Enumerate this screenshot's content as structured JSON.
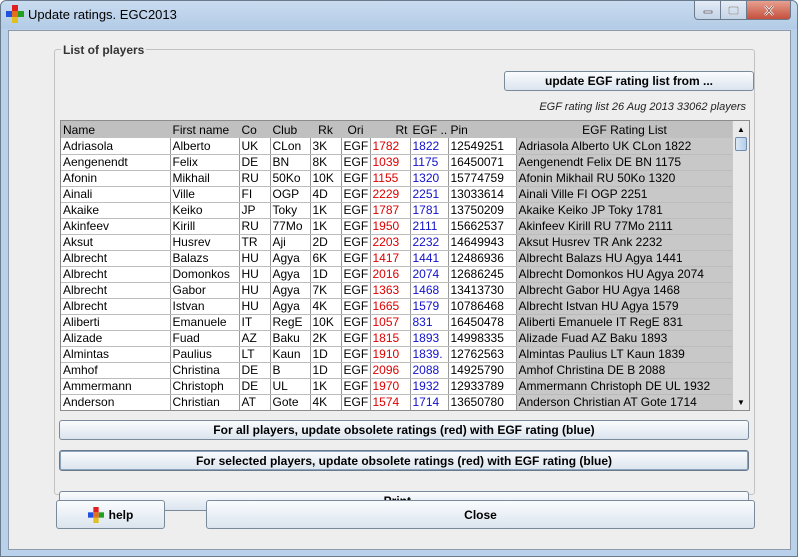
{
  "window": {
    "title": "Update ratings. EGC2013",
    "icons": [
      "app-logo-icon",
      "minimize-icon",
      "maximize-icon",
      "close-icon"
    ]
  },
  "group": {
    "title": "List of players",
    "update_list_label": "update EGF rating list from ...",
    "rating_info": "EGF rating list 26 Aug 2013 33062 players"
  },
  "table": {
    "columns": [
      "Name",
      "First name",
      "Co",
      "Club",
      "Rk",
      "Ori",
      "Rt",
      "EGF ...",
      "Pin",
      "EGF Rating List"
    ],
    "rows": [
      [
        "Adriasola",
        "Alberto",
        "UK",
        "CLon",
        "3K",
        "EGF",
        "1782",
        "1822",
        "12549251",
        "Adriasola Alberto UK CLon 1822"
      ],
      [
        "Aengenendt",
        "Felix",
        "DE",
        "BN",
        "8K",
        "EGF",
        "1039",
        "1175",
        "16450071",
        "Aengenendt Felix DE BN 1175"
      ],
      [
        "Afonin",
        "Mikhail",
        "RU",
        "50Ko",
        "10K",
        "EGF",
        "1155",
        "1320",
        "15774759",
        "Afonin Mikhail RU 50Ko 1320"
      ],
      [
        "Ainali",
        "Ville",
        "FI",
        "OGP",
        "4D",
        "EGF",
        "2229",
        "2251",
        "13033614",
        "Ainali Ville FI OGP 2251"
      ],
      [
        "Akaike",
        "Keiko",
        "JP",
        "Toky",
        "1K",
        "EGF",
        "1787",
        "1781",
        "13750209",
        "Akaike Keiko JP Toky 1781"
      ],
      [
        "Akinfeev",
        "Kirill",
        "RU",
        "77Mo",
        "1K",
        "EGF",
        "1950",
        "2111",
        "15662537",
        "Akinfeev Kirill RU 77Mo 2111"
      ],
      [
        "Aksut",
        "Husrev",
        "TR",
        "Aji",
        "2D",
        "EGF",
        "2203",
        "2232",
        "14649943",
        "Aksut Husrev TR Ank 2232"
      ],
      [
        "Albrecht",
        "Balazs",
        "HU",
        "Agya",
        "6K",
        "EGF",
        "1417",
        "1441",
        "12486936",
        "Albrecht Balazs HU Agya 1441"
      ],
      [
        "Albrecht",
        "Domonkos",
        "HU",
        "Agya",
        "1D",
        "EGF",
        "2016",
        "2074",
        "12686245",
        "Albrecht Domonkos HU Agya 2074"
      ],
      [
        "Albrecht",
        "Gabor",
        "HU",
        "Agya",
        "7K",
        "EGF",
        "1363",
        "1468",
        "13413730",
        "Albrecht Gabor HU Agya 1468"
      ],
      [
        "Albrecht",
        "Istvan",
        "HU",
        "Agya",
        "4K",
        "EGF",
        "1665",
        "1579",
        "10786468",
        "Albrecht Istvan HU Agya 1579"
      ],
      [
        "Aliberti",
        "Emanuele",
        "IT",
        "RegE",
        "10K",
        "EGF",
        "1057",
        "831",
        "16450478",
        "Aliberti Emanuele IT RegE 831"
      ],
      [
        "Alizade",
        "Fuad",
        "AZ",
        "Baku",
        "2K",
        "EGF",
        "1815",
        "1893",
        "14998335",
        "Alizade Fuad AZ Baku 1893"
      ],
      [
        "Almintas",
        "Paulius",
        "LT",
        "Kaun",
        "1D",
        "EGF",
        "1910",
        "1839.",
        "12762563",
        "Almintas Paulius LT Kaun 1839"
      ],
      [
        "Amhof",
        "Christina",
        "DE",
        "B",
        "1D",
        "EGF",
        "2096",
        "2088",
        "14925790",
        "Amhof Christina DE B 2088"
      ],
      [
        "Ammermann",
        "Christoph",
        "DE",
        "UL",
        "1K",
        "EGF",
        "1970",
        "1932",
        "12933789",
        "Ammermann Christoph DE UL 1932"
      ],
      [
        "Anderson",
        "Christian",
        "AT",
        "Gote",
        "4K",
        "EGF",
        "1574",
        "1714",
        "13650780",
        "Anderson Christian AT Gote 1714"
      ]
    ]
  },
  "buttons": {
    "update_all": "For all players, update obsolete ratings (red) with EGF rating (blue)",
    "update_selected": "For selected players, update obsolete ratings (red) with EGF rating (blue)",
    "print": "Print ...",
    "help": "help",
    "close": "Close"
  },
  "colors": {
    "obsolete_rating": "#dd0000",
    "egf_rating": "#1010cc",
    "window_frame": "#b9d1ea",
    "client_bg": "#eeeeee"
  }
}
